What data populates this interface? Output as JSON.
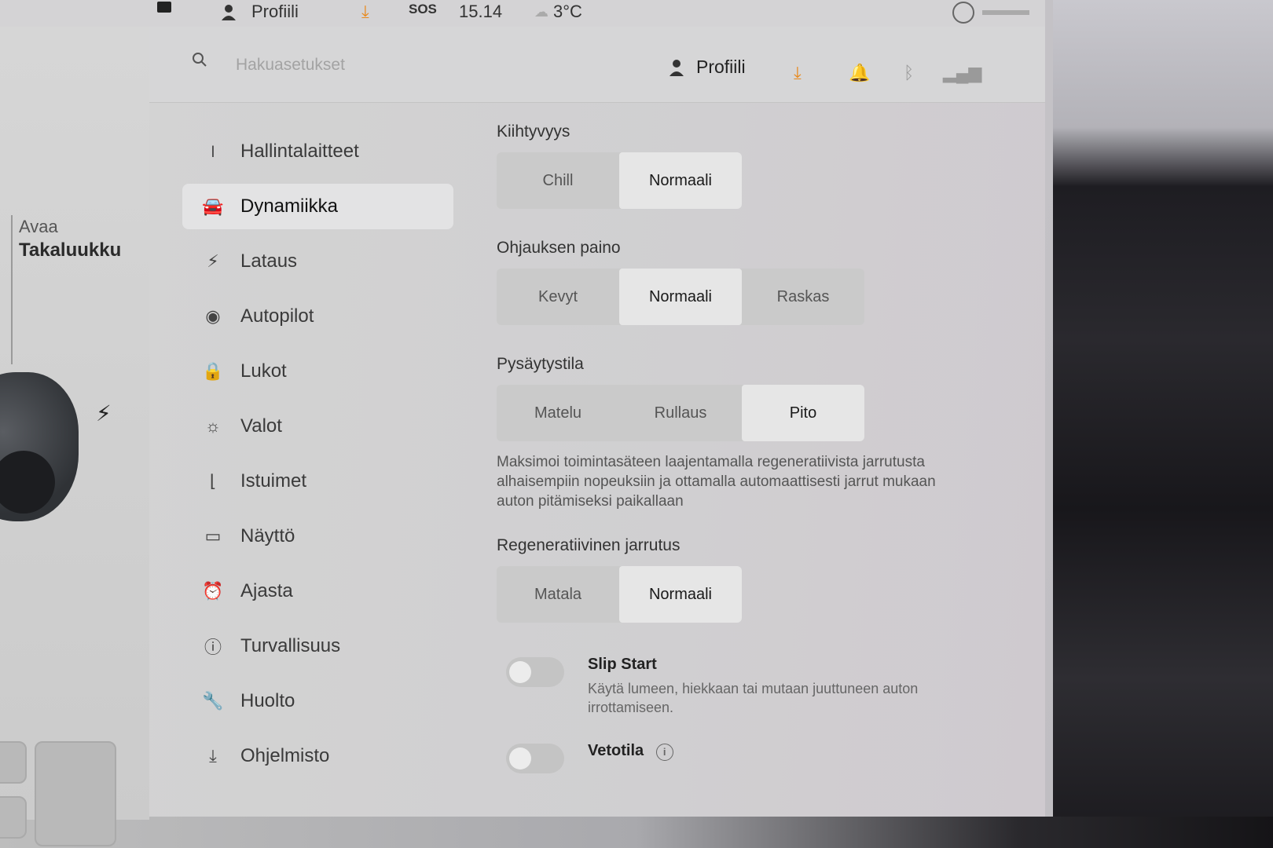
{
  "status_bar": {
    "profile_label": "Profiili",
    "sos_label": "SOS",
    "time": "15.14",
    "temperature": "3°C"
  },
  "left_panel": {
    "trunk_line1": "Avaa",
    "trunk_line2": "Takaluukku"
  },
  "header": {
    "search_placeholder": "Hakuasetukset",
    "profile_label": "Profiili"
  },
  "sidebar": {
    "items": [
      {
        "label": "Hallintalaitteet",
        "icon": "toggle-icon",
        "glyph": "⏽"
      },
      {
        "label": "Dynamiikka",
        "icon": "car-icon",
        "glyph": "🚘"
      },
      {
        "label": "Lataus",
        "icon": "bolt-icon",
        "glyph": "⚡"
      },
      {
        "label": "Autopilot",
        "icon": "steering-wheel-icon",
        "glyph": "◉"
      },
      {
        "label": "Lukot",
        "icon": "lock-icon",
        "glyph": "🔒"
      },
      {
        "label": "Valot",
        "icon": "light-icon",
        "glyph": "☼"
      },
      {
        "label": "Istuimet",
        "icon": "seat-icon",
        "glyph": "⌊"
      },
      {
        "label": "Näyttö",
        "icon": "display-icon",
        "glyph": "▭"
      },
      {
        "label": "Ajasta",
        "icon": "alarm-clock-icon",
        "glyph": "⏰"
      },
      {
        "label": "Turvallisuus",
        "icon": "info-circle-icon",
        "glyph": "ⓘ"
      },
      {
        "label": "Huolto",
        "icon": "wrench-icon",
        "glyph": "🔧"
      },
      {
        "label": "Ohjelmisto",
        "icon": "download-icon",
        "glyph": "⤓"
      }
    ]
  },
  "content": {
    "acceleration": {
      "title": "Kiihtyvyys",
      "options": [
        "Chill",
        "Normaali"
      ]
    },
    "steering": {
      "title": "Ohjauksen paino",
      "options": [
        "Kevyt",
        "Normaali",
        "Raskas"
      ]
    },
    "stop_mode": {
      "title": "Pysäytystila",
      "options": [
        "Matelu",
        "Rullaus",
        "Pito"
      ],
      "description": "Maksimoi toimintasäteen laajentamalla regeneratiivista jarrutusta alhaisempiin nopeuksiin ja ottamalla automaattisesti jarrut mukaan auton pitämiseksi paikallaan"
    },
    "regen": {
      "title": "Regeneratiivinen jarrutus",
      "options": [
        "Matala",
        "Normaali"
      ]
    },
    "slip_start": {
      "label": "Slip Start",
      "description": "Käytä lumeen, hiekkaan tai mutaan juuttuneen auton irrottamiseen."
    },
    "traction": {
      "label": "Vetotila"
    }
  },
  "colors": {
    "accent_download": "#e8891c"
  }
}
